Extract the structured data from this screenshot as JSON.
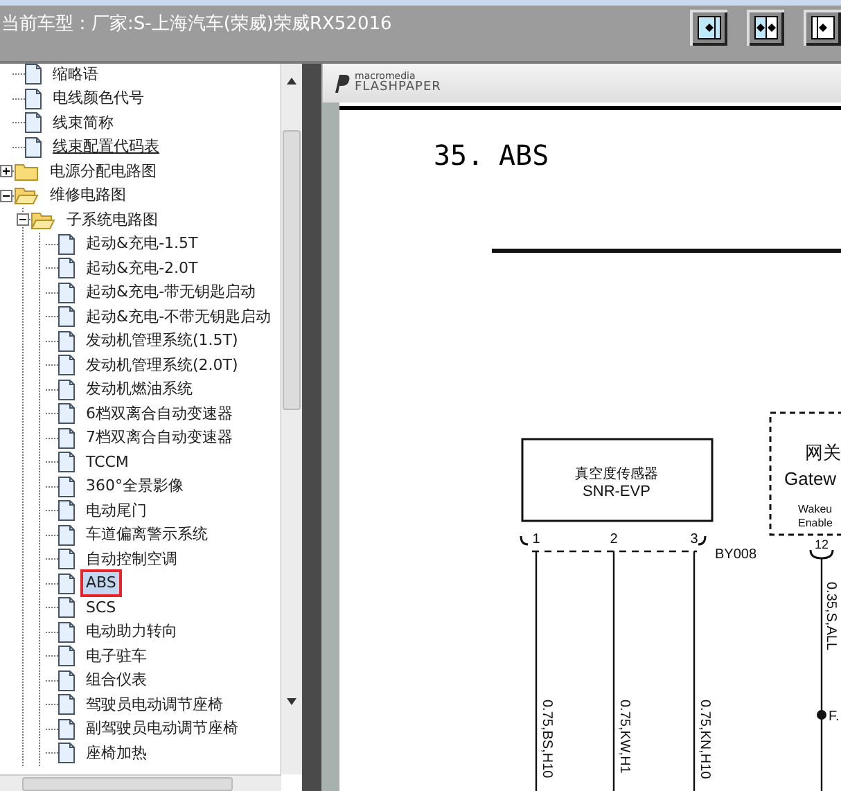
{
  "header": {
    "title": "当前车型：厂家:S-上海汽车(荣威)荣威RX52016"
  },
  "toolbar": {
    "buttons": [
      {
        "kind": "single"
      },
      {
        "kind": "split"
      },
      {
        "kind": "single-left"
      }
    ]
  },
  "tree": [
    {
      "label": "缩略语",
      "kind": "document",
      "selected": false,
      "marked": false,
      "hovered": false
    },
    {
      "label": "电线颜色代号",
      "kind": "document",
      "selected": false,
      "marked": false,
      "hovered": false
    },
    {
      "label": "线束简称",
      "kind": "document",
      "selected": false,
      "marked": false,
      "hovered": false
    },
    {
      "label": "线束配置代码表",
      "kind": "document",
      "selected": false,
      "marked": false,
      "hovered": true
    },
    {
      "label": "电源分配电路图",
      "kind": "folder",
      "expanded": false,
      "selected": false,
      "marked": false,
      "hovered": false
    },
    {
      "label": "维修电路图",
      "kind": "folder",
      "expanded": true,
      "selected": false,
      "marked": false,
      "hovered": false,
      "children": [
        {
          "label": "子系统电路图",
          "kind": "folder",
          "expanded": true,
          "selected": false,
          "marked": false,
          "hovered": false,
          "children": [
            {
              "label": "起动&充电-1.5T",
              "kind": "document",
              "selected": false,
              "marked": false,
              "hovered": false
            },
            {
              "label": "起动&充电-2.0T",
              "kind": "document",
              "selected": false,
              "marked": false,
              "hovered": false
            },
            {
              "label": "起动&充电-带无钥匙启动",
              "kind": "document",
              "selected": false,
              "marked": false,
              "hovered": false
            },
            {
              "label": "起动&充电-不带无钥匙启动",
              "kind": "document",
              "selected": false,
              "marked": false,
              "hovered": false
            },
            {
              "label": "发动机管理系统(1.5T)",
              "kind": "document",
              "selected": false,
              "marked": false,
              "hovered": false
            },
            {
              "label": "发动机管理系统(2.0T)",
              "kind": "document",
              "selected": false,
              "marked": false,
              "hovered": false
            },
            {
              "label": "发动机燃油系统",
              "kind": "document",
              "selected": false,
              "marked": false,
              "hovered": false
            },
            {
              "label": "6档双离合自动变速器",
              "kind": "document",
              "selected": false,
              "marked": false,
              "hovered": false
            },
            {
              "label": "7档双离合自动变速器",
              "kind": "document",
              "selected": false,
              "marked": false,
              "hovered": false
            },
            {
              "label": "TCCM",
              "kind": "document",
              "selected": false,
              "marked": false,
              "hovered": false
            },
            {
              "label": "360°全景影像",
              "kind": "document",
              "selected": false,
              "marked": false,
              "hovered": false
            },
            {
              "label": "电动尾门",
              "kind": "document",
              "selected": false,
              "marked": false,
              "hovered": false
            },
            {
              "label": "车道偏离警示系统",
              "kind": "document",
              "selected": false,
              "marked": false,
              "hovered": false
            },
            {
              "label": "自动控制空调",
              "kind": "document",
              "selected": false,
              "marked": false,
              "hovered": false
            },
            {
              "label": "ABS",
              "kind": "document",
              "selected": true,
              "marked": true,
              "hovered": false
            },
            {
              "label": "SCS",
              "kind": "document",
              "selected": false,
              "marked": false,
              "hovered": false
            },
            {
              "label": "电动助力转向",
              "kind": "document",
              "selected": false,
              "marked": false,
              "hovered": false
            },
            {
              "label": "电子驻车",
              "kind": "document",
              "selected": false,
              "marked": false,
              "hovered": false
            },
            {
              "label": "组合仪表",
              "kind": "document",
              "selected": false,
              "marked": false,
              "hovered": false
            },
            {
              "label": "驾驶员电动调节座椅",
              "kind": "document",
              "selected": false,
              "marked": false,
              "hovered": false
            },
            {
              "label": "副驾驶员电动调节座椅",
              "kind": "document",
              "selected": false,
              "marked": false,
              "hovered": false
            },
            {
              "label": "座椅加热",
              "kind": "document",
              "selected": false,
              "marked": false,
              "hovered": false
            }
          ]
        }
      ]
    }
  ],
  "viewer": {
    "logo_top": "macromedia",
    "logo_bottom": "FLASHPAPER",
    "page": {
      "section_number": "35.",
      "section_title": "ABS",
      "sensor": {
        "name_cn": "真空度传感器",
        "name_en": "SNR-EVP",
        "connector": "BY008",
        "pins": [
          "1",
          "2",
          "3"
        ],
        "wires": [
          "0.75,BS,H10",
          "0.75,KW,H1",
          "0.75,KN,H10"
        ]
      },
      "gateway": {
        "name_cn": "网关",
        "name_en": "Gatew",
        "line_1": "Wakeu",
        "line_2": "Enable",
        "pin": "12",
        "wire": "0.35,S,ALL",
        "splice": "F."
      }
    }
  }
}
